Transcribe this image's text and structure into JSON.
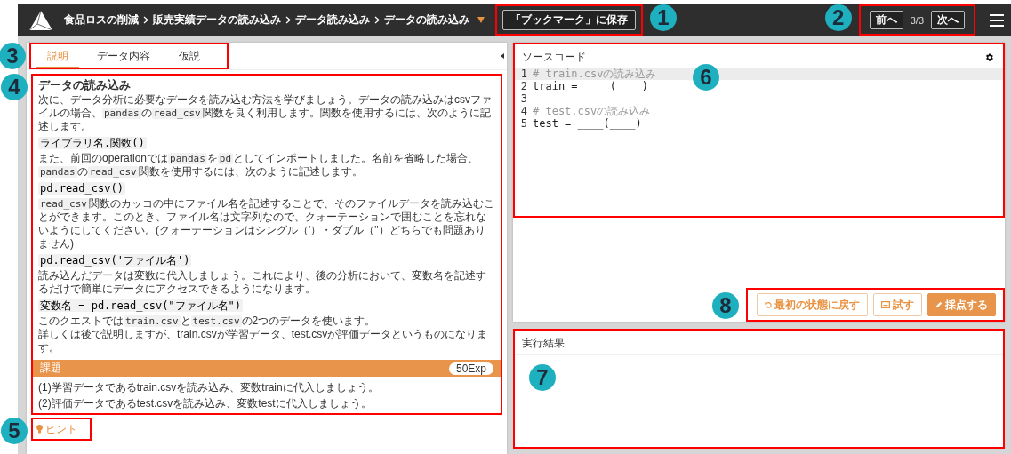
{
  "header": {
    "breadcrumbs": [
      "食品ロスの削減",
      "販売実績データの読み込み",
      "データ読み込み",
      "データの読み込み"
    ],
    "bookmark_button": "「ブックマーク」に保存",
    "prev_button": "前へ",
    "page_counter": "3/3",
    "next_button": "次へ"
  },
  "tabs": [
    {
      "label": "説明",
      "selected": true
    },
    {
      "label": "データ内容",
      "selected": false
    },
    {
      "label": "仮説",
      "selected": false
    }
  ],
  "lesson": {
    "title": "データの読み込み",
    "blocks": [
      {
        "kind": "paragraph",
        "parts": [
          {
            "kind": "text",
            "text": "次に、データ分析に必要なデータを読み込む方法を学びましょう。データの読み込みはcsvファイルの場合、"
          },
          {
            "kind": "code",
            "text": "pandas"
          },
          {
            "kind": "text",
            "text": "の"
          },
          {
            "kind": "code",
            "text": "read_csv"
          },
          {
            "kind": "text",
            "text": "関数を良く利用します。関数を使用するには、次のように記述します。"
          }
        ]
      },
      {
        "kind": "code",
        "text": "ライブラリ名.関数()"
      },
      {
        "kind": "paragraph",
        "parts": [
          {
            "kind": "text",
            "text": "また、前回のoperationでは"
          },
          {
            "kind": "code",
            "text": "pandas"
          },
          {
            "kind": "text",
            "text": "を"
          },
          {
            "kind": "code",
            "text": "pd"
          },
          {
            "kind": "text",
            "text": "としてインポートしました。名前を省略した場合、"
          },
          {
            "kind": "code",
            "text": "pandas"
          },
          {
            "kind": "text",
            "text": "の"
          },
          {
            "kind": "code",
            "text": "read_csv"
          },
          {
            "kind": "text",
            "text": "関数を使用するには、次のように記述します。"
          }
        ]
      },
      {
        "kind": "code",
        "text": "pd.read_csv()"
      },
      {
        "kind": "paragraph",
        "parts": [
          {
            "kind": "code",
            "text": "read_csv"
          },
          {
            "kind": "text",
            "text": "関数のカッコの中にファイル名を記述することで、そのファイルデータを読み込むことができます。このとき、ファイル名は文字列なので、クォーテーションで囲むことを忘れないようにしてください。(クォーテーションはシングル（'）・ダブル（\"）どちらでも問題ありません)"
          }
        ]
      },
      {
        "kind": "code",
        "text": "pd.read_csv('ファイル名')"
      },
      {
        "kind": "paragraph",
        "parts": [
          {
            "kind": "text",
            "text": "読み込んだデータは変数に代入しましょう。これにより、後の分析において、変数名を記述するだけで簡単にデータにアクセスできるようになります。"
          }
        ]
      },
      {
        "kind": "code",
        "text": "変数名 = pd.read_csv(\"ファイル名\")"
      },
      {
        "kind": "paragraph",
        "parts": [
          {
            "kind": "text",
            "text": "このクエストでは"
          },
          {
            "kind": "code",
            "text": "train.csv"
          },
          {
            "kind": "text",
            "text": "と"
          },
          {
            "kind": "code",
            "text": "test.csv"
          },
          {
            "kind": "text",
            "text": "の2つのデータを使います。"
          },
          {
            "kind": "break"
          },
          {
            "kind": "text",
            "text": "詳しくは後で説明しますが、train.csvが学習データ、test.csvが評価データというものになります。"
          }
        ]
      }
    ]
  },
  "task": {
    "title": "課題",
    "exp": "50Exp",
    "items": [
      "(1)学習データであるtrain.csvを読み込み、変数trainに代入しましょう。",
      "(2)評価データであるtest.csvを読み込み、変数testに代入しましょう。"
    ]
  },
  "hint": "ヒント",
  "editor": {
    "title": "ソースコード",
    "lines": [
      {
        "number": "1",
        "text": "# train.csvの読み込み",
        "kind": "comment",
        "highlighted": true
      },
      {
        "number": "2",
        "text": "train = ____(____)",
        "kind": "code",
        "highlighted": false
      },
      {
        "number": "3",
        "kind": "blank",
        "highlighted": false
      },
      {
        "number": "4",
        "text": "# test.csvの読み込み",
        "kind": "comment",
        "highlighted": false
      },
      {
        "number": "5",
        "text": "test = ____(____)",
        "kind": "code",
        "highlighted": false
      }
    ]
  },
  "actions": {
    "reset_button": "最初の状態に戻す",
    "try_button": "試す",
    "grade_button": "採点する"
  },
  "result": {
    "title": "実行結果"
  },
  "annotations": [
    "1",
    "2",
    "3",
    "4",
    "5",
    "6",
    "7",
    "8"
  ]
}
